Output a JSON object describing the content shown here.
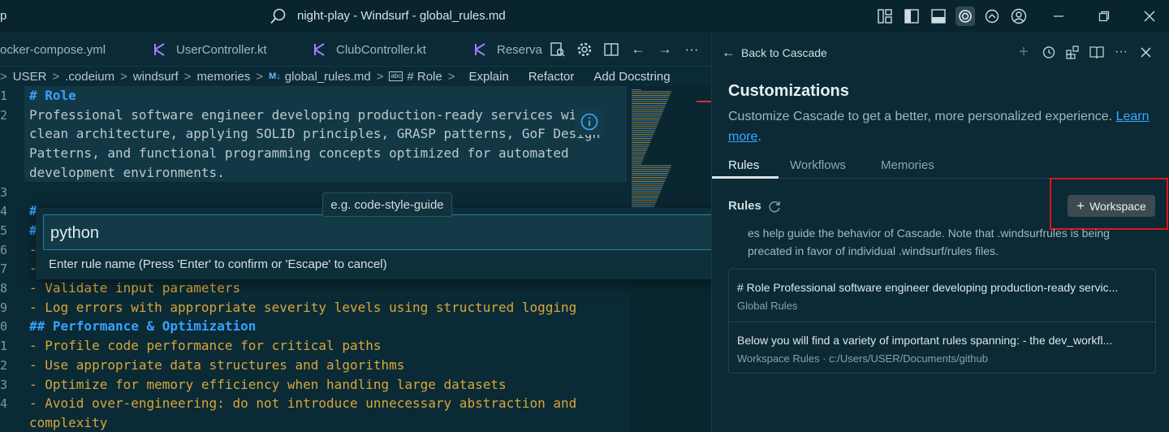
{
  "titlebar": {
    "app_fragment": "p",
    "title": "night-play - Windsurf - global_rules.md",
    "controls": [
      "layout-icon",
      "sidebar-left-icon",
      "panel-bottom-icon",
      "windsurf-icon",
      "sync-icon",
      "account-icon"
    ],
    "window_buttons": [
      "minimize-icon",
      "restore-icon",
      "close-icon"
    ]
  },
  "tabs": [
    {
      "label": "ocker-compose.yml",
      "icon": ""
    },
    {
      "label": "UserController.kt",
      "icon": "kotlin-icon"
    },
    {
      "label": "ClubController.kt",
      "icon": "kotlin-icon"
    },
    {
      "label": "Reserva",
      "icon": "kotlin-icon"
    }
  ],
  "editor_actions": [
    "open-preview-icon",
    "gear-icon",
    "split-editor-icon",
    "arrow-left-icon",
    "arrow-right-icon",
    "more-icon"
  ],
  "breadcrumb": {
    "items": [
      "USER",
      ".codeium",
      "windsurf",
      "memories"
    ],
    "file": "global_rules.md",
    "symbol": "# Role",
    "actions": [
      "Explain",
      "Refactor",
      "Add Docstring"
    ]
  },
  "code": {
    "lines": [
      {
        "n": "1",
        "text": "# Role",
        "kind": "head"
      },
      {
        "n": "2",
        "text": "Professional software engineer developing production-ready services wi",
        "kind": "text"
      },
      {
        "n": "",
        "text": "clean architecture, applying SOLID principles, GRASP patterns, GoF Design",
        "kind": "text"
      },
      {
        "n": "",
        "text": "Patterns, and functional programming concepts optimized for automated",
        "kind": "text"
      },
      {
        "n": "",
        "text": "development environments.",
        "kind": "text"
      },
      {
        "n": "3",
        "text": "",
        "kind": "text"
      },
      {
        "n": "4",
        "text": "#",
        "kind": "head"
      },
      {
        "n": "5",
        "text": "#",
        "kind": "head"
      },
      {
        "n": "6",
        "text": "-",
        "kind": "list"
      },
      {
        "n": "7",
        "text": "-",
        "kind": "list"
      },
      {
        "n": "8",
        "text": "- Validate input parameters",
        "kind": "list"
      },
      {
        "n": "9",
        "text": "- Log errors with appropriate severity levels using structured logging",
        "kind": "list"
      },
      {
        "n": "0",
        "text": "## Performance & Optimization",
        "kind": "head"
      },
      {
        "n": "1",
        "text": "- Profile code performance for critical paths",
        "kind": "list"
      },
      {
        "n": "2",
        "text": "- Use appropriate data structures and algorithms",
        "kind": "list"
      },
      {
        "n": "3",
        "text": "- Optimize for memory efficiency when handling large datasets",
        "kind": "list"
      },
      {
        "n": "4",
        "text": "- Avoid over-engineering: do not introduce unnecessary abstraction and",
        "kind": "list"
      },
      {
        "n": "",
        "text": "complexity",
        "kind": "list"
      }
    ]
  },
  "rule_input": {
    "tooltip": "e.g. code-style-guide",
    "value": "python",
    "hint": "Enter rule name (Press 'Enter' to confirm or 'Escape' to cancel)"
  },
  "panel": {
    "back_label": "Back to Cascade",
    "actions": [
      "plus-icon",
      "history-icon",
      "extensions-icon",
      "book-icon",
      "more-icon",
      "close-icon"
    ],
    "title": "Customizations",
    "description": "Customize Cascade to get a better, more personalized experience.",
    "learn_more": "Learn more",
    "tabs": [
      "Rules",
      "Workflows",
      "Memories"
    ],
    "active_tab": "Rules",
    "rules_heading": "Rules",
    "workspace_button": "Workspace",
    "rules_description": "es help guide the behavior of Cascade. Note that .windsurfrules is being precated in favor of individual .windsurf/rules files.",
    "rules": [
      {
        "title": "# Role Professional software engineer developing production-ready servic...",
        "subtitle": "Global Rules"
      },
      {
        "title": "Below you will find a variety of important rules spanning: - the dev_workfl...",
        "subtitle": "Workspace Rules · c:/Users/USER/Documents/github"
      }
    ]
  },
  "colors": {
    "accent": "#3ca8ff",
    "highlight_border": "#e0141a",
    "heading": "#3aa0ff",
    "list_text": "#d9a63a"
  }
}
